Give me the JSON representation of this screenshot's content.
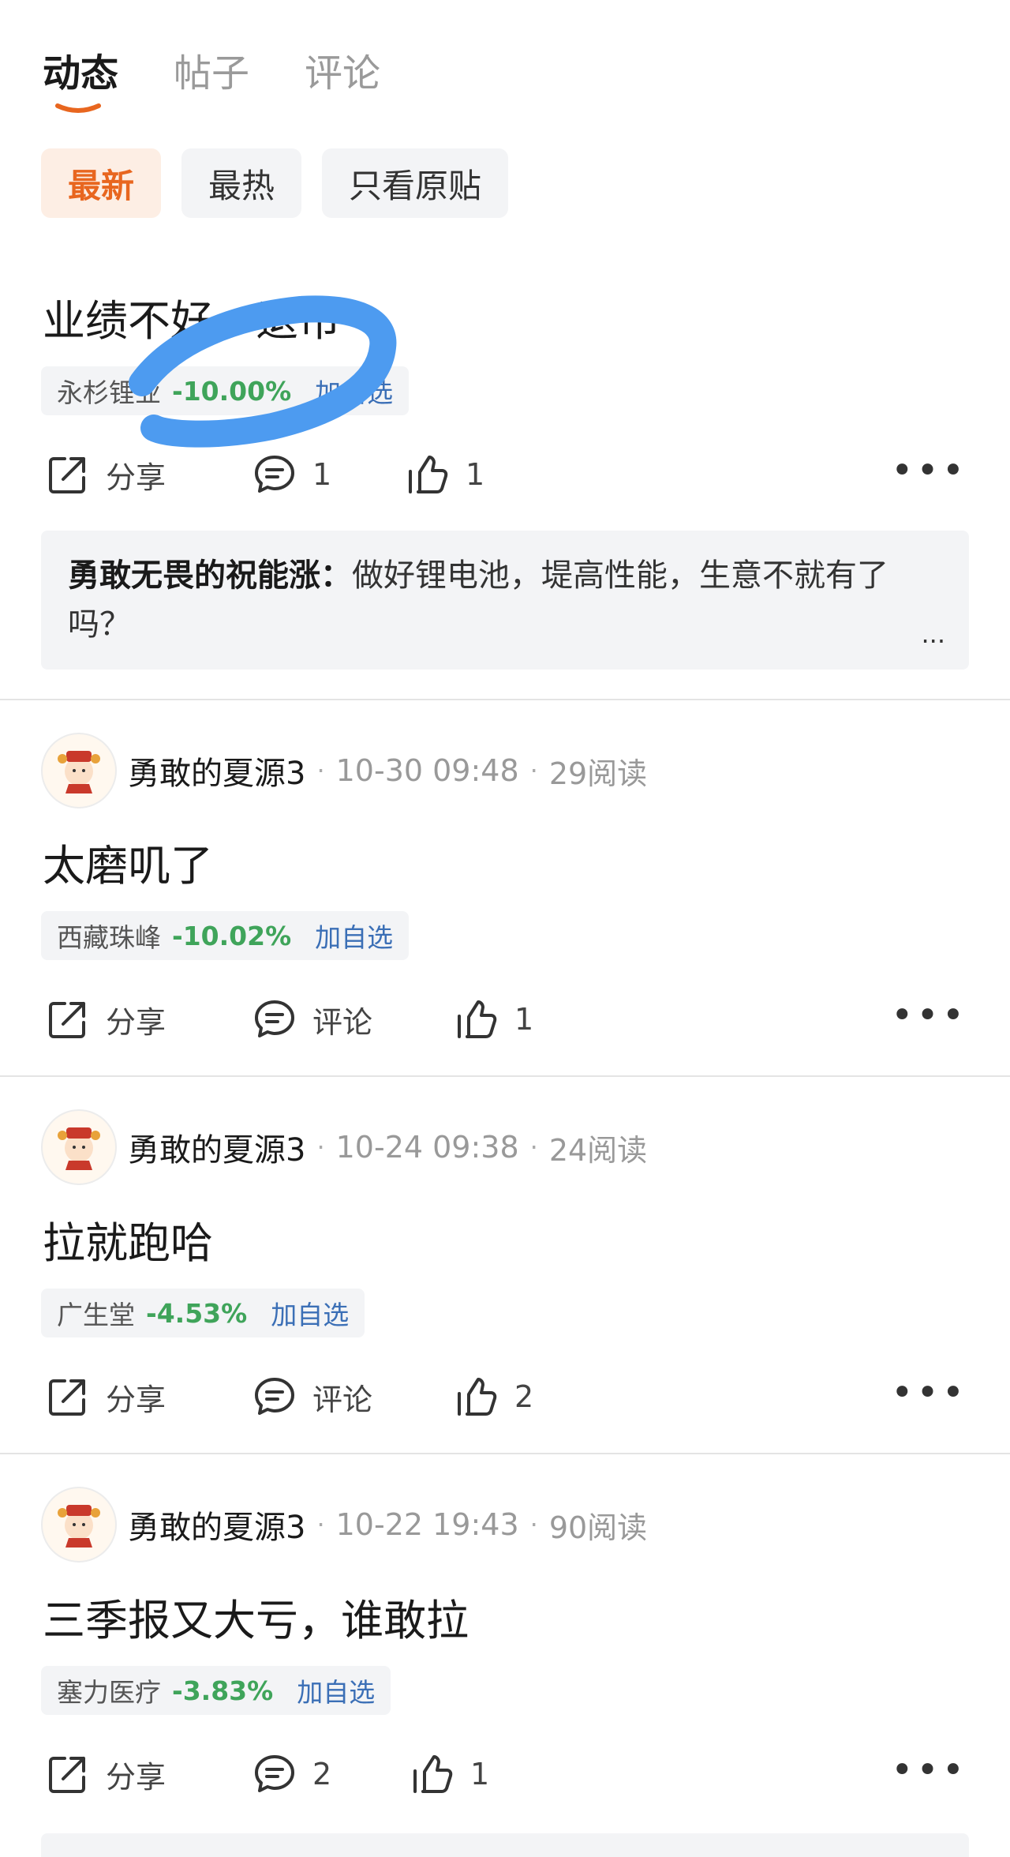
{
  "tabs": [
    {
      "label": "动态",
      "active": true
    },
    {
      "label": "帖子",
      "active": false
    },
    {
      "label": "评论",
      "active": false
    }
  ],
  "filters": [
    {
      "label": "最新",
      "active": true
    },
    {
      "label": "最热",
      "active": false
    },
    {
      "label": "只看原贴",
      "active": false
    }
  ],
  "colors": {
    "accent": "#e8661f",
    "rise_fall_green": "#3fa45a",
    "link_blue": "#3b6fb6",
    "scribble": "#4d9bf0"
  },
  "posts": [
    {
      "text": "业绩不好，退市",
      "stock": {
        "name": "永杉锂业",
        "change": "-10.00%",
        "add": "加自选"
      },
      "actions": {
        "share": "分享",
        "comment": "1",
        "like": "1"
      },
      "reply": {
        "author": "勇敢无畏的祝能涨：",
        "text": "做好锂电池，堤高性能，生意不就有了吗？",
        "more": "..."
      }
    },
    {
      "author": "勇敢的夏源3",
      "time": "10-30 09:48",
      "reads": "29阅读",
      "text": "太磨叽了",
      "stock": {
        "name": "西藏珠峰",
        "change": "-10.02%",
        "add": "加自选"
      },
      "actions": {
        "share": "分享",
        "comment": "评论",
        "like": "1"
      }
    },
    {
      "author": "勇敢的夏源3",
      "time": "10-24 09:38",
      "reads": "24阅读",
      "text": "拉就跑哈",
      "stock": {
        "name": "广生堂",
        "change": "-4.53%",
        "add": "加自选"
      },
      "actions": {
        "share": "分享",
        "comment": "评论",
        "like": "2"
      }
    },
    {
      "author": "勇敢的夏源3",
      "time": "10-22 19:43",
      "reads": "90阅读",
      "text": "三季报又大亏，谁敢拉",
      "stock": {
        "name": "塞力医疗",
        "change": "-3.83%",
        "add": "加自选"
      },
      "actions": {
        "share": "分享",
        "comment": "2",
        "like": "1"
      }
    }
  ],
  "more_label": "•••"
}
